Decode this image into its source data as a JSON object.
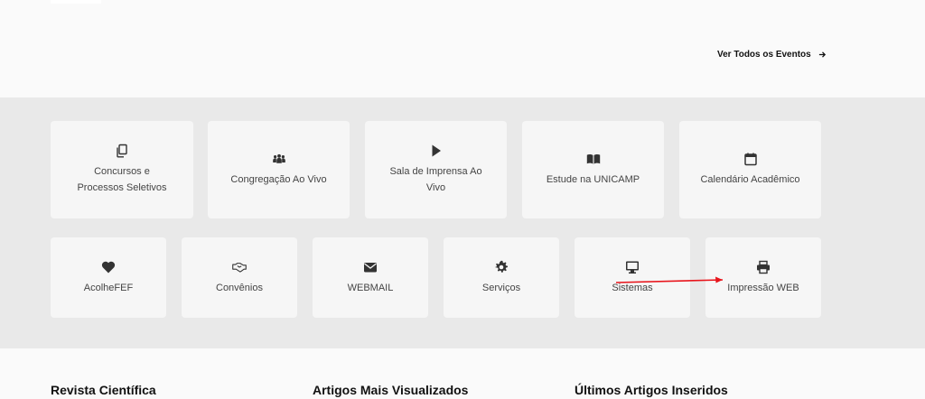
{
  "events": {
    "see_all_label": "Ver Todos os Eventos"
  },
  "tiles_row1": [
    {
      "label": "Concursos e\nProcessos Seletivos",
      "icon": "copy-icon"
    },
    {
      "label": "Congregação Ao Vivo",
      "icon": "users-icon"
    },
    {
      "label": "Sala de Imprensa Ao\nVivo",
      "icon": "play-icon"
    },
    {
      "label": "Estude na UNICAMP",
      "icon": "book-icon"
    },
    {
      "label": "Calendário Acadêmico",
      "icon": "calendar-icon"
    }
  ],
  "tiles_row2": [
    {
      "label": "AcolheFEF",
      "icon": "heart-icon"
    },
    {
      "label": "Convênios",
      "icon": "handshake-icon"
    },
    {
      "label": "WEBMAIL",
      "icon": "envelope-icon"
    },
    {
      "label": "Serviços",
      "icon": "gear-icon"
    },
    {
      "label": "Sistemas",
      "icon": "desktop-icon"
    },
    {
      "label": "Impressão WEB",
      "icon": "printer-icon"
    }
  ],
  "footer_columns": {
    "col1_title": "Revista Científica",
    "col2_title": "Artigos Mais Visualizados",
    "col3_title": "Últimos Artigos Inseridos"
  },
  "colors": {
    "annotation_arrow": "#e8141b",
    "icon": "#333333"
  }
}
